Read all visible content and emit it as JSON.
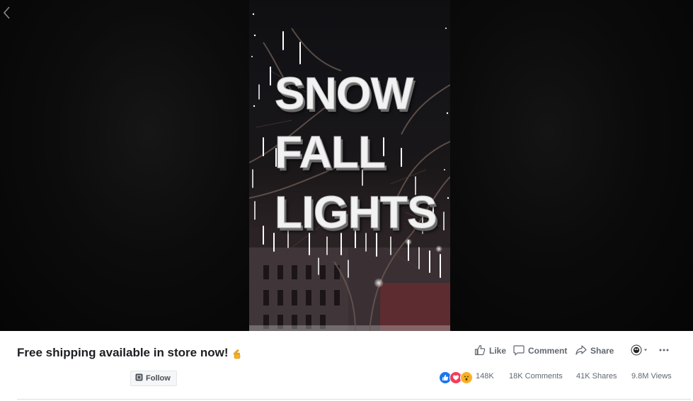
{
  "video": {
    "overlay_lines": [
      "SNOW",
      "FALL",
      "LIGHTS"
    ]
  },
  "post": {
    "caption": "Free shipping available in store now!",
    "caption_emoji": "pointing-hand",
    "follow_label": "Follow"
  },
  "actions": {
    "like": "Like",
    "comment": "Comment",
    "share": "Share"
  },
  "stats": {
    "reactions_count": "148K",
    "comments": "18K Comments",
    "shares": "41K Shares",
    "views": "9.8M Views"
  },
  "icons": {
    "back": "chevron-left-icon",
    "like": "thumbs-up-icon",
    "comment": "comment-bubble-icon",
    "share": "share-arrow-icon",
    "more": "more-dots-icon",
    "follow": "follow-icon",
    "page_selector": "avatar-dropdown-icon"
  },
  "colors": {
    "reaction_like": "#1877f2",
    "reaction_love": "#f33e58",
    "reaction_wow": "#f7b125"
  }
}
